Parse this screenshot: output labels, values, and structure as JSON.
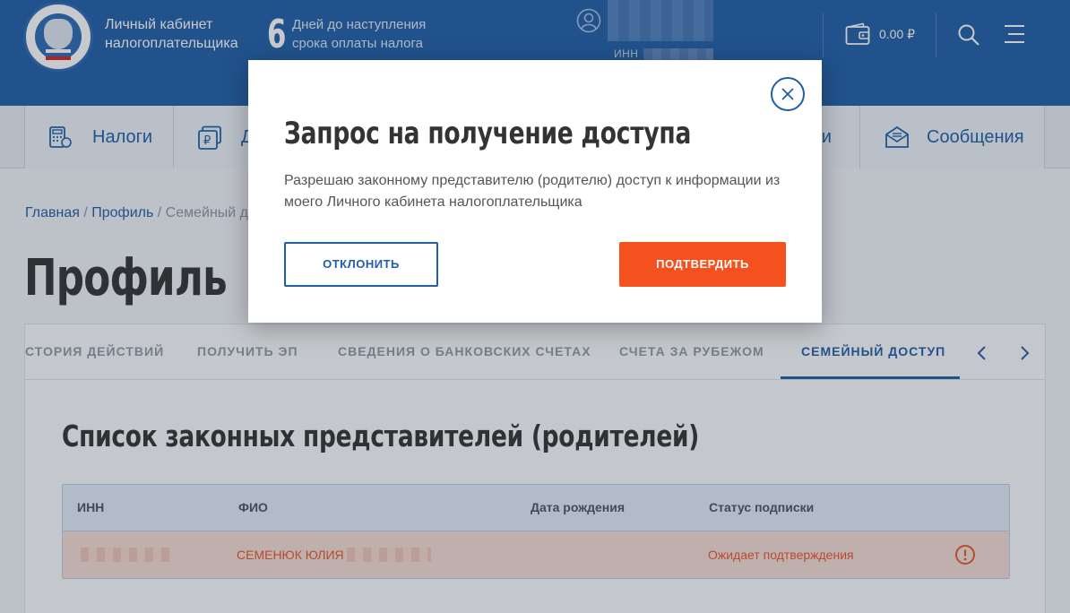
{
  "header": {
    "brand_line1": "Личный кабинет",
    "brand_line2": "налогоплательщика",
    "days_number": "6",
    "days_line1": "Дней до наступления",
    "days_line2": "срока оплаты налога",
    "inn_label": "ИНН",
    "balance": "0.00 ₽"
  },
  "nav": {
    "items": [
      {
        "label": "Налоги",
        "icon": "calculator-icon"
      },
      {
        "label": "Д",
        "icon": "ruble-document-icon"
      },
      {
        "label": "ми",
        "icon": ""
      },
      {
        "label": "Сообщения",
        "icon": "envelope-icon"
      }
    ]
  },
  "breadcrumb": {
    "home": "Главная",
    "profile": "Профиль",
    "current": "Семейный д"
  },
  "page": {
    "title": "Профиль"
  },
  "tabs": [
    {
      "label": "СТОРИЯ ДЕЙСТВИЙ",
      "active": false
    },
    {
      "label": "ПОЛУЧИТЬ ЭП",
      "active": false
    },
    {
      "label": "СВЕДЕНИЯ О БАНКОВСКИХ СЧЕТАХ",
      "active": false
    },
    {
      "label": "СЧЕТА ЗА РУБЕЖОМ",
      "active": false
    },
    {
      "label": "СЕМЕЙНЫЙ ДОСТУП",
      "active": true
    }
  ],
  "section": {
    "title": "Список законных представителей (родителей)"
  },
  "table": {
    "columns": [
      "ИНН",
      "ФИО",
      "Дата рождения",
      "Статус подписки"
    ],
    "rows": [
      {
        "inn": "",
        "fio": "СЕМЕНЮК ЮЛИЯ",
        "birth_date": "",
        "status": "Ожидает подтверждения"
      }
    ]
  },
  "modal": {
    "title": "Запрос на получение доступа",
    "text": "Разрешаю законному представителю (родителю) доступ к информации из моего Личного кабинета налогоплательщика",
    "decline": "ОТКЛОНИТЬ",
    "confirm": "ПОДТВЕРДИТЬ"
  },
  "colors": {
    "brand_blue": "#1f5fa8",
    "accent_orange": "#f4511e",
    "warning_row": "#f6ddd4"
  }
}
